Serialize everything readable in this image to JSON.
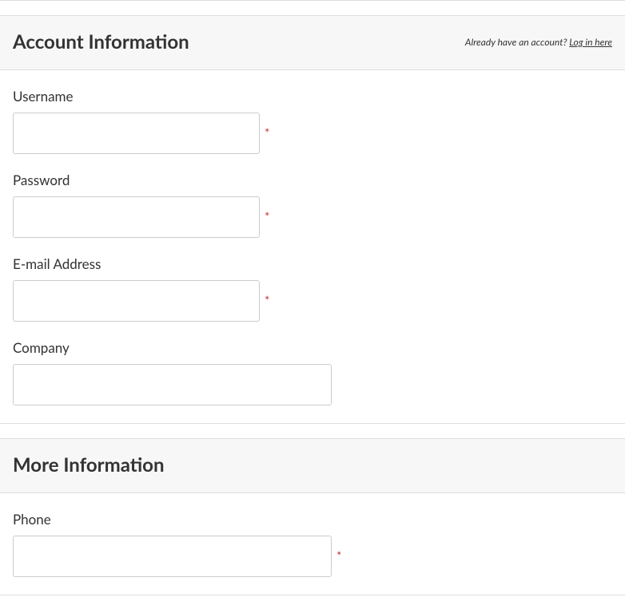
{
  "section1": {
    "title": "Account Information",
    "prompt_text": "Already have an account? ",
    "login_link": "Log in here",
    "fields": {
      "username": {
        "label": "Username",
        "required": "*"
      },
      "password": {
        "label": "Password",
        "required": "*"
      },
      "email": {
        "label": "E-mail Address",
        "required": "*"
      },
      "company": {
        "label": "Company"
      }
    }
  },
  "section2": {
    "title": "More Information",
    "fields": {
      "phone": {
        "label": "Phone",
        "required": "*"
      }
    }
  }
}
